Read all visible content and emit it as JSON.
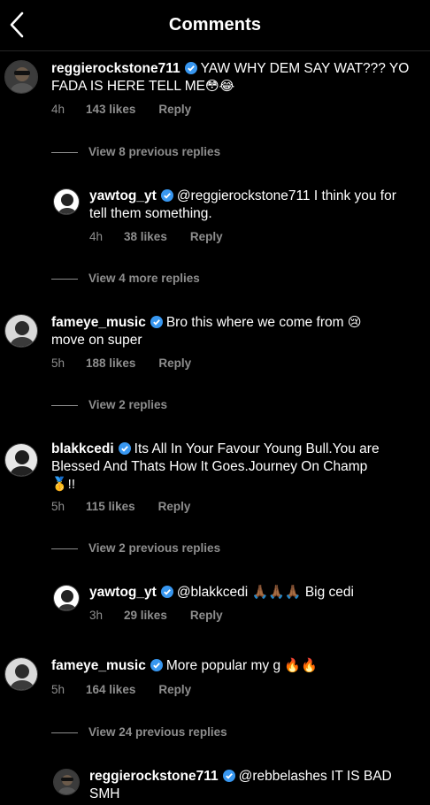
{
  "header": {
    "title": "Comments"
  },
  "comments": [
    {
      "user": "reggierockstone711",
      "text": "YAW WHY DEM SAY WAT??? YO FADA IS HERE TELL ME",
      "emoji": "😳😂",
      "time": "4h",
      "likes": "143 likes",
      "reply": "Reply"
    },
    {
      "view": "View 8 previous replies"
    },
    {
      "user": "yawtog_yt",
      "text": "@reggierockstone711 I think you for tell them something.",
      "time": "4h",
      "likes": "38 likes",
      "reply": "Reply"
    },
    {
      "view": "View 4 more replies"
    },
    {
      "user": "fameye_music",
      "text": "Bro this where we come from",
      "emoji": "😢",
      "text2": "move on super",
      "time": "5h",
      "likes": "188 likes",
      "reply": "Reply"
    },
    {
      "view": "View 2 replies"
    },
    {
      "user": "blakkcedi",
      "text": "Its All In Your Favour Young Bull.You are Blessed And Thats How It Goes.Journey On Champ",
      "emoji": "🥇!!",
      "time": "5h",
      "likes": "115 likes",
      "reply": "Reply"
    },
    {
      "view": "View 2 previous replies"
    },
    {
      "user": "yawtog_yt",
      "text": "@blakkcedi",
      "emoji": "🙏🏾🙏🏾🙏🏾",
      "text2": "Big cedi",
      "time": "3h",
      "likes": "29 likes",
      "reply": "Reply"
    },
    {
      "user": "fameye_music",
      "text": "More popular my g",
      "emoji": "🔥🔥",
      "time": "5h",
      "likes": "164 likes",
      "reply": "Reply"
    },
    {
      "view": "View 24 previous replies"
    },
    {
      "user": "reggierockstone711",
      "text": "@rebbelashes IT IS BAD SMH"
    }
  ],
  "colors": {
    "background": "#000000",
    "meta": "#8e8e8e",
    "verified": "#3897f0"
  }
}
